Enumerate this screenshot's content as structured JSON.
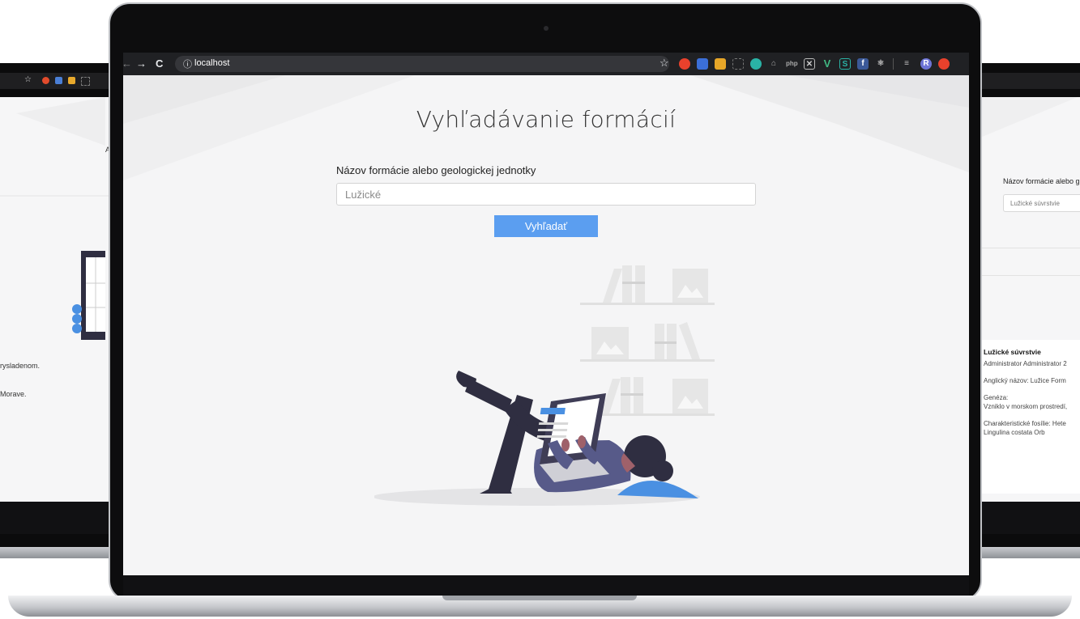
{
  "browser": {
    "url": "localhost",
    "nav": {
      "back": "←",
      "forward": "→",
      "reload": "C",
      "info": "ⓘ",
      "star": "☆"
    }
  },
  "page": {
    "title": "Vyhľadávanie formácií",
    "field_label": "Názov formácie alebo geologickej jednotky",
    "search_placeholder": "Lužické",
    "search_button": "Vyhľadať"
  },
  "left_screen": {
    "visible_letter": "A",
    "line1": "rysladenom.",
    "line2": "Morave."
  },
  "right_screen": {
    "field_label": "Názov formácie alebo g",
    "input_value": "Lužické súvrstvie",
    "result": {
      "title": "Lužické súvrstvie",
      "author": "Administrator Administrator 2",
      "english_name": "Anglický názov: Lužice Form",
      "genesis_label": "Genéza:",
      "genesis_text": "Vzniklo v morskom prostredí,",
      "fossils": "Charakteristické fosílie: Hete",
      "fossils_cont": "Lingulina costata Orb"
    }
  },
  "colors": {
    "accent": "#5b9ef0",
    "background": "#f5f5f6",
    "figure_dark": "#2f2e41",
    "figure_purple": "#575a89"
  }
}
